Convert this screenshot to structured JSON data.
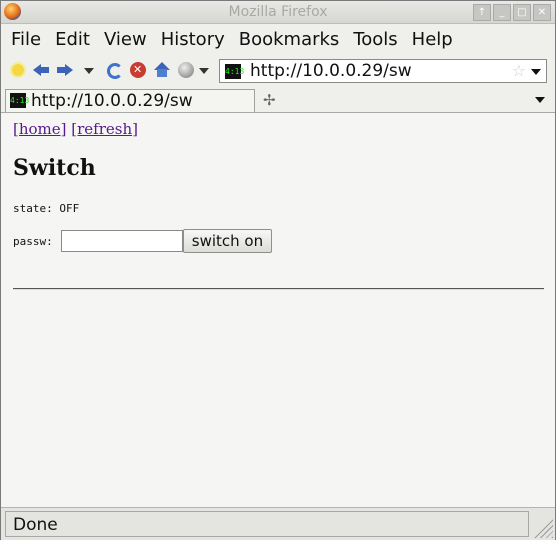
{
  "window": {
    "title": "Mozilla Firefox",
    "buttons": [
      "↑",
      "_",
      "□",
      "✕"
    ]
  },
  "menubar": {
    "items": [
      "File",
      "Edit",
      "View",
      "History",
      "Bookmarks",
      "Tools",
      "Help"
    ]
  },
  "toolbar": {
    "url": "http://10.0.0.29/sw",
    "favicon_text": "4:13",
    "star_glyph": "☆"
  },
  "tabs": {
    "items": [
      {
        "label": "http://10.0.0.29/sw"
      }
    ],
    "new_tab_glyph": "✢"
  },
  "page": {
    "links": {
      "home": "[home]",
      "refresh": "[refresh]"
    },
    "heading": "Switch",
    "state_text": "state: OFF",
    "passw_label": "passw:",
    "passw_value": "",
    "button_label": "switch on"
  },
  "status": {
    "text": "Done"
  }
}
